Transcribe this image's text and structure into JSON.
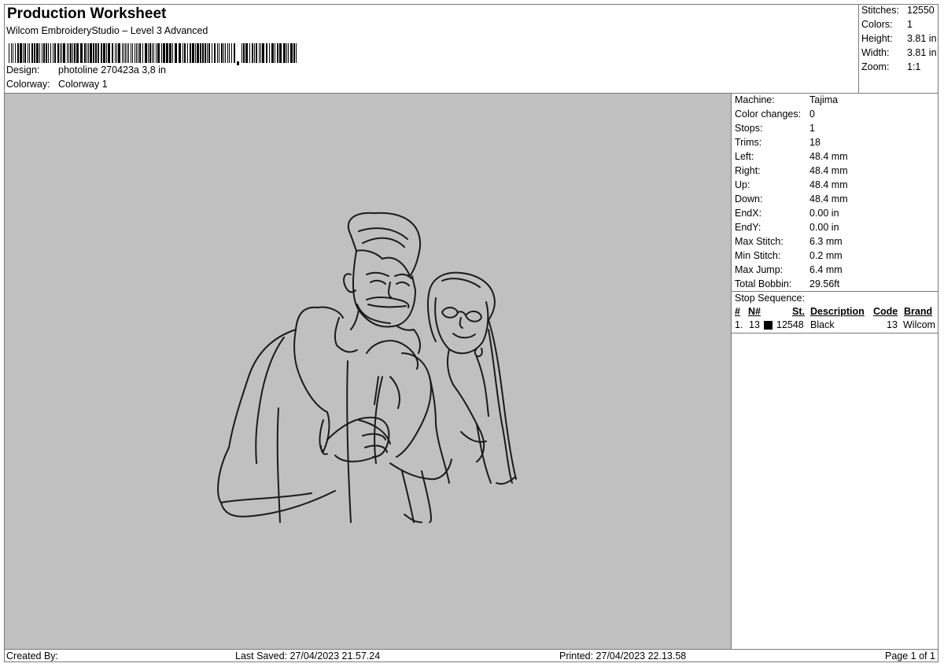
{
  "header": {
    "title": "Production Worksheet",
    "subtitle": "Wilcom EmbroideryStudio – Level 3 Advanced",
    "design_label": "Design:",
    "design_value": "photoline 270423a 3,8 in",
    "colorway_label": "Colorway:",
    "colorway_value": "Colorway 1"
  },
  "stats": [
    {
      "label": "Stitches:",
      "value": "12550"
    },
    {
      "label": "Colors:",
      "value": "1"
    },
    {
      "label": "Height:",
      "value": "3.81 in"
    },
    {
      "label": "Width:",
      "value": "3.81 in"
    },
    {
      "label": "Zoom:",
      "value": "1:1"
    }
  ],
  "properties": [
    {
      "label": "Machine:",
      "value": "Tajima"
    },
    {
      "label": "Color changes:",
      "value": "0"
    },
    {
      "label": "Stops:",
      "value": "1"
    },
    {
      "label": "Trims:",
      "value": "18"
    },
    {
      "label": "Left:",
      "value": "48.4 mm"
    },
    {
      "label": "Right:",
      "value": "48.4 mm"
    },
    {
      "label": "Up:",
      "value": "48.4 mm"
    },
    {
      "label": "Down:",
      "value": "48.4 mm"
    },
    {
      "label": "EndX:",
      "value": "0.00 in"
    },
    {
      "label": "EndY:",
      "value": "0.00 in"
    },
    {
      "label": "Max Stitch:",
      "value": "6.3 mm"
    },
    {
      "label": "Min Stitch:",
      "value": "0.2 mm"
    },
    {
      "label": "Max Jump:",
      "value": "6.4 mm"
    },
    {
      "label": "Total Bobbin:",
      "value": "29.56ft"
    }
  ],
  "stop_sequence": {
    "title": "Stop Sequence:",
    "columns": [
      "#",
      "N#",
      "St.",
      "Description",
      "Code",
      "Brand"
    ],
    "rows": [
      {
        "num": "1.",
        "n": "13",
        "swatch_color": "#000000",
        "st": "12548",
        "description": "Black",
        "code": "13",
        "brand": "Wilcom"
      }
    ]
  },
  "footer": {
    "created_by": "Created By:",
    "last_saved": "Last Saved: 27/04/2023 21.57.24",
    "printed": "Printed: 27/04/2023 22.13.58",
    "page": "Page 1 of 1"
  },
  "colors": {
    "canvas_bg": "#c0c0c0",
    "thread": "#1a1a1a"
  }
}
